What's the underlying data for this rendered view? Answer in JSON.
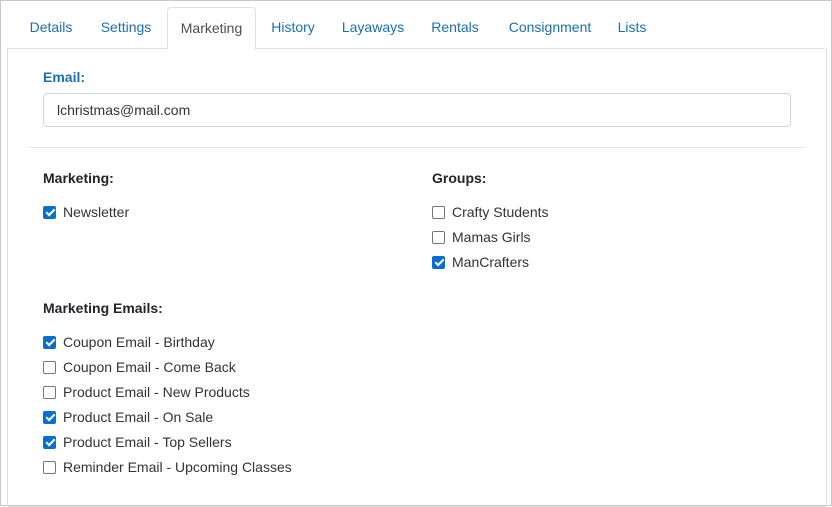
{
  "tabs": [
    "Details",
    "Settings",
    "Marketing",
    "History",
    "Layaways",
    "Rentals",
    "Consignment",
    "Lists"
  ],
  "active_tab": "Marketing",
  "email": {
    "label": "Email:",
    "value": "lchristmas@mail.com"
  },
  "marketing": {
    "label": "Marketing:",
    "items": [
      {
        "label": "Newsletter",
        "checked": true
      }
    ]
  },
  "groups": {
    "label": "Groups:",
    "items": [
      {
        "label": "Crafty Students",
        "checked": false
      },
      {
        "label": "Mamas Girls",
        "checked": false
      },
      {
        "label": "ManCrafters",
        "checked": true
      }
    ]
  },
  "marketing_emails": {
    "label": "Marketing Emails:",
    "items": [
      {
        "label": "Coupon Email - Birthday",
        "checked": true
      },
      {
        "label": "Coupon Email - Come Back",
        "checked": false
      },
      {
        "label": "Product Email - New Products",
        "checked": false
      },
      {
        "label": "Product Email - On Sale",
        "checked": true
      },
      {
        "label": "Product Email - Top Sellers",
        "checked": true
      },
      {
        "label": "Reminder Email - Upcoming Classes",
        "checked": false
      }
    ]
  },
  "colors": {
    "link": "#1a6fb3",
    "checkbox_checked": "#0a6ed1",
    "border": "#dee2e6"
  }
}
